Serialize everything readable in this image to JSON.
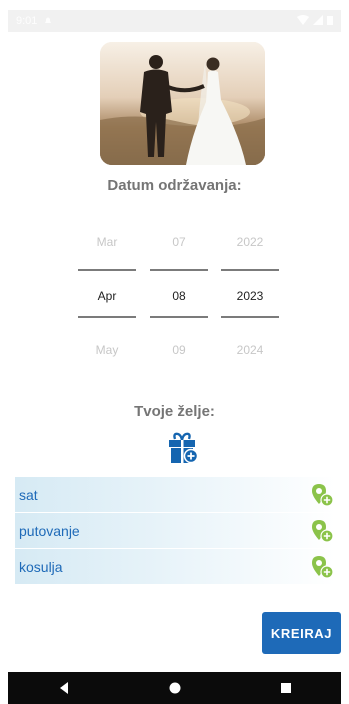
{
  "status_bar": {
    "time": "9:01"
  },
  "hero": {
    "icon": "wedding-couple-photo"
  },
  "date_section": {
    "title": "Datum održavanja:",
    "month": {
      "prev": "Mar",
      "selected": "Apr",
      "next": "May"
    },
    "day": {
      "prev": "07",
      "selected": "08",
      "next": "09"
    },
    "year": {
      "prev": "2022",
      "selected": "2023",
      "next": "2024"
    }
  },
  "wishes_section": {
    "title": "Tvoje želje:",
    "add_icon": "gift-add-icon",
    "items": [
      {
        "label": "sat"
      },
      {
        "label": "putovanje"
      },
      {
        "label": "kosulja"
      }
    ]
  },
  "actions": {
    "create_label": "KREIRAJ"
  },
  "colors": {
    "accent": "#1e6ab8",
    "title": "#757575",
    "row_bg": "#d6eaf4",
    "item_icon": "#8bc34a"
  }
}
